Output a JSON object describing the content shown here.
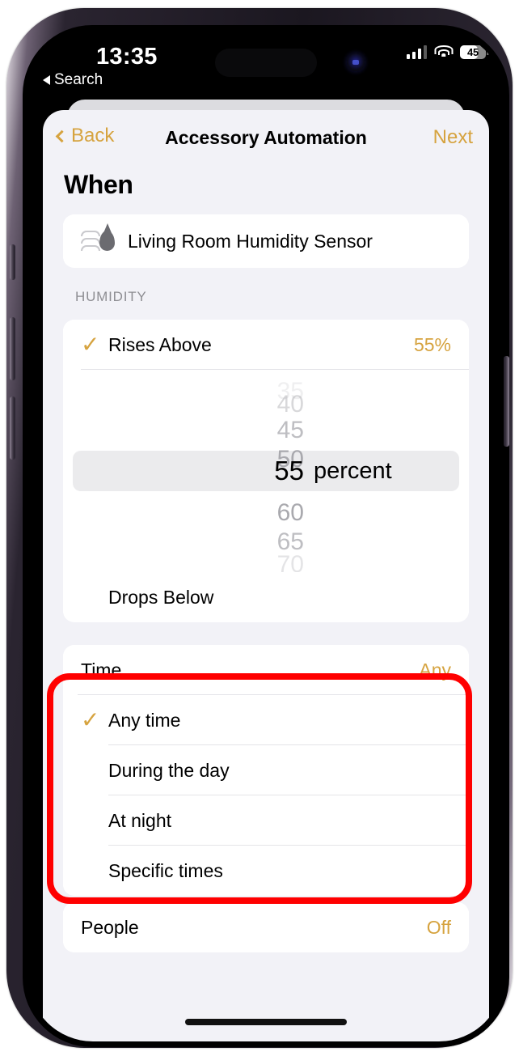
{
  "status_bar": {
    "time": "13:35",
    "back_label": "Search",
    "battery_level": "45",
    "signal_icon": "cellular-bars-icon",
    "wifi_icon": "wifi-icon",
    "battery_icon": "battery-icon"
  },
  "nav": {
    "back_label": "Back",
    "title": "Accessory Automation",
    "next_label": "Next"
  },
  "page": {
    "heading": "When"
  },
  "accessory": {
    "name": "Living Room Humidity Sensor",
    "icon": "humidity-sensor-icon"
  },
  "humidity_section": {
    "header": "HUMIDITY",
    "rises_above": {
      "label": "Rises Above",
      "value": "55%",
      "selected": true
    },
    "drops_below": {
      "label": "Drops Below",
      "selected": false
    },
    "picker": {
      "unit": "percent",
      "selected_value": "55",
      "options": [
        "35",
        "40",
        "45",
        "50",
        "55",
        "60",
        "65",
        "70"
      ]
    }
  },
  "time_section": {
    "header_label": "Time",
    "header_value": "Any",
    "options": [
      {
        "label": "Any time",
        "selected": true
      },
      {
        "label": "During the day",
        "selected": false
      },
      {
        "label": "At night",
        "selected": false
      },
      {
        "label": "Specific times",
        "selected": false
      }
    ]
  },
  "people_section": {
    "label": "People",
    "value": "Off"
  },
  "annotation": {
    "color": "#ff0000",
    "shape": "rounded-rectangle"
  },
  "colors": {
    "accent": "#d6a33f",
    "background": "#f2f2f7",
    "card": "#ffffff",
    "text": "#000000",
    "muted": "#8e8e93"
  }
}
